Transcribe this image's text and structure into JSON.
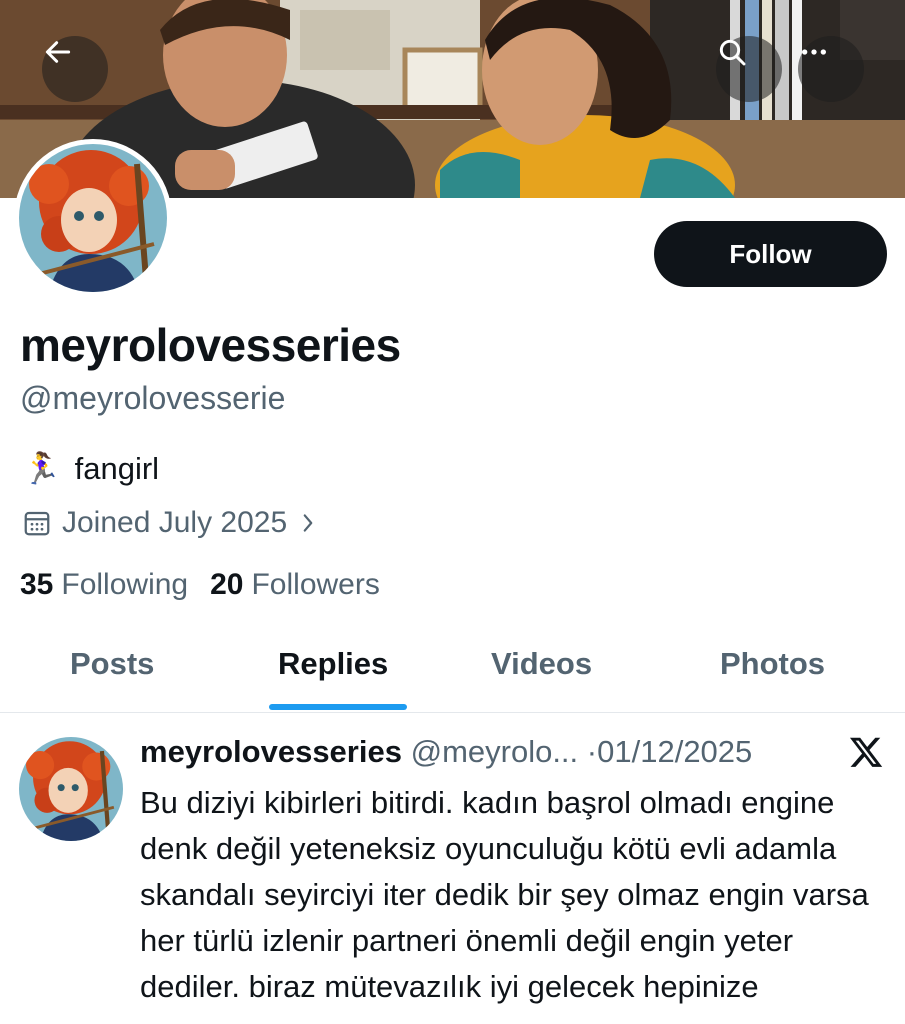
{
  "header": {
    "back_icon": "arrow-left-icon",
    "search_icon": "search-icon",
    "more_icon": "more-horizontal-icon"
  },
  "profile": {
    "display_name": "meyrolovesseries",
    "handle": "@meyrolovesserie",
    "bio_emoji": "🏃‍♀️",
    "bio": "fangirl",
    "joined": "Joined July 2025",
    "following_count": "35",
    "following_label": "Following",
    "followers_count": "20",
    "followers_label": "Followers",
    "follow_label": "Follow"
  },
  "tabs": [
    {
      "label": "Posts",
      "active": false
    },
    {
      "label": "Replies",
      "active": true
    },
    {
      "label": "Videos",
      "active": false
    },
    {
      "label": "Photos",
      "active": false
    }
  ],
  "post": {
    "name": "meyrolovesseries",
    "handle": "@meyrolo...",
    "separator": "·",
    "date": "01/12/2025",
    "text": "Bu diziyi kibirleri bitirdi. kadın başrol olmadı engine denk değil yeteneksiz oyunculuğu kötü evli adamla skandalı seyirciyi iter dedik bir şey olmaz engin varsa her türlü izlenir partneri önemli değil engin yeter dediler. biraz mütevazılık iyi gelecek hepinize"
  },
  "colors": {
    "accent": "#1d9bf0",
    "text": "#0f1419",
    "muted": "#536471",
    "follow_bg": "#0f1419"
  }
}
